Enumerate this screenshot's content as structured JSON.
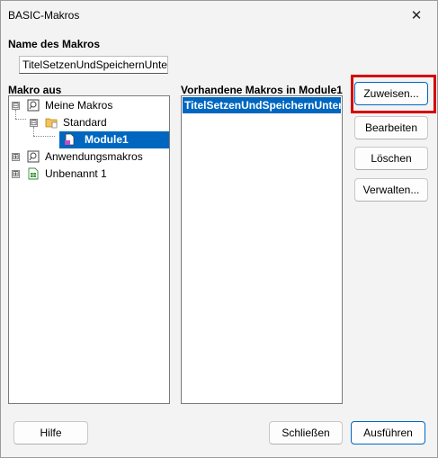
{
  "window": {
    "title": "BASIC-Makros",
    "close_glyph": "✕"
  },
  "macro_name": {
    "label": "Name des Makros",
    "value": "TitelSetzenUndSpeichernUnter"
  },
  "macro_from": {
    "label": "Makro aus",
    "tree": [
      {
        "label": "Meine Makros",
        "expander": "⊟"
      },
      {
        "label": "Standard",
        "expander": "⊟"
      },
      {
        "label": "Module1",
        "selected": true
      },
      {
        "label": "Anwendungsmakros",
        "expander": "⊞"
      },
      {
        "label": "Unbenannt 1",
        "expander": "⊞"
      }
    ]
  },
  "existing_macros": {
    "label": "Vorhandene Makros in Module1",
    "items": [
      "TitelSetzenUndSpeichernUnter"
    ]
  },
  "buttons": {
    "assign": "Zuweisen...",
    "edit": "Bearbeiten",
    "delete": "Löschen",
    "manage": "Verwalten...",
    "help": "Hilfe",
    "close": "Schließen",
    "run": "Ausführen"
  },
  "colors": {
    "selection": "#0067c0",
    "highlight": "#d40000"
  }
}
